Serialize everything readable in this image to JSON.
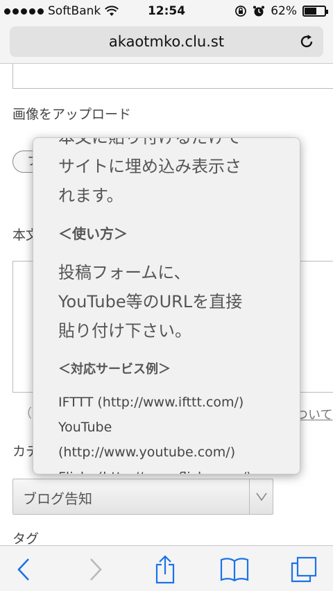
{
  "status_bar": {
    "carrier": "SoftBank",
    "time": "12:54",
    "battery": "62%",
    "battery_level": 0.62
  },
  "browser": {
    "url": "akaotmko.clu.st"
  },
  "form": {
    "upload_label": "画像をアップロード",
    "upload_button": "フ",
    "body_label": "本文",
    "help_prefix": "（",
    "help_link": "ついて",
    "category_label": "カテ",
    "category_value": "ブログ告知",
    "tag_label": "タグ"
  },
  "popup": {
    "cut_line": "本文に貼り付けるだけで",
    "line1": "サイトに埋め込み表示さ",
    "line2": "れます。",
    "heading_usage": "＜使い方＞",
    "usage_1": "投稿フォームに、",
    "usage_2": "YouTube等のURLを直接",
    "usage_3": "貼り付け下さい。",
    "heading_services": "＜対応サービス例＞",
    "services": [
      "IFTTT (http://www.ifttt.com/)",
      "YouTube",
      "(http://www.youtube.com/)",
      "Flickr (http://www.flickr.com/)"
    ]
  },
  "colors": {
    "bar_bg": "#f4f4f4",
    "accent": "#1a73e8"
  }
}
